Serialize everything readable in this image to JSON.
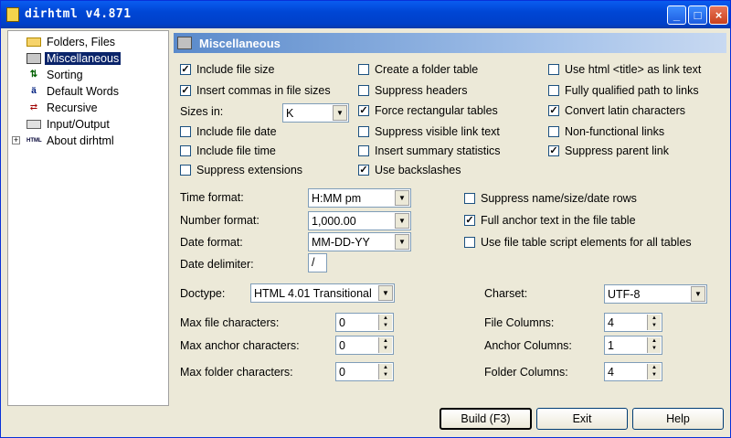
{
  "window": {
    "title": "dirhtml v4.871",
    "min": "_",
    "max": "□",
    "close": "×"
  },
  "tree": {
    "items": [
      {
        "label": "Folders, Files",
        "icon": "folder-icon",
        "selected": false
      },
      {
        "label": "Miscellaneous",
        "icon": "misc-icon",
        "selected": true
      },
      {
        "label": "Sorting",
        "icon": "sort-icon",
        "selected": false
      },
      {
        "label": "Default Words",
        "icon": "words-icon",
        "selected": false
      },
      {
        "label": "Recursive",
        "icon": "recursive-icon",
        "selected": false
      },
      {
        "label": "Input/Output",
        "icon": "io-icon",
        "selected": false
      },
      {
        "label": "About dirhtml",
        "icon": "html-icon",
        "selected": false
      }
    ],
    "expander": "+"
  },
  "header": {
    "title": "Miscellaneous"
  },
  "col1": [
    {
      "label": "Include file size",
      "checked": true
    },
    {
      "label": "Insert commas in file sizes",
      "checked": true
    },
    {
      "label": "Include file date",
      "checked": false
    },
    {
      "label": "Include file time",
      "checked": false
    },
    {
      "label": "Suppress extensions",
      "checked": false
    }
  ],
  "sizes": {
    "label": "Sizes in:",
    "value": "K"
  },
  "col2": [
    {
      "label": "Create a folder table",
      "checked": false
    },
    {
      "label": "Suppress headers",
      "checked": false
    },
    {
      "label": "Force rectangular tables",
      "checked": true
    },
    {
      "label": "Suppress visible link text",
      "checked": false
    },
    {
      "label": "Insert summary statistics",
      "checked": false
    },
    {
      "label": "Use backslashes",
      "checked": true
    }
  ],
  "col3": [
    {
      "label": "Use html <title> as link text",
      "checked": false
    },
    {
      "label": "Fully qualified path to links",
      "checked": false
    },
    {
      "label": "Convert latin characters",
      "checked": true
    },
    {
      "label": "Non-functional links",
      "checked": false
    },
    {
      "label": "Suppress parent link",
      "checked": true
    }
  ],
  "formats": {
    "time": {
      "label": "Time format:",
      "value": "H:MM pm"
    },
    "number": {
      "label": "Number format:",
      "value": "1,000.00"
    },
    "date": {
      "label": "Date format:",
      "value": "MM-DD-YY"
    },
    "delimiter": {
      "label": "Date delimiter:",
      "value": "/"
    }
  },
  "col4": [
    {
      "label": "Suppress name/size/date rows",
      "checked": false
    },
    {
      "label": "Full anchor text in the file table",
      "checked": true
    },
    {
      "label": "Use file table script elements for all tables",
      "checked": false
    }
  ],
  "doctype": {
    "label": "Doctype:",
    "value": "HTML 4.01 Transitional"
  },
  "charset": {
    "label": "Charset:",
    "value": "UTF-8"
  },
  "spins": {
    "max_file": {
      "label": "Max file characters:",
      "value": "0"
    },
    "max_anchor": {
      "label": "Max anchor characters:",
      "value": "0"
    },
    "max_folder": {
      "label": "Max folder characters:",
      "value": "0"
    },
    "file_cols": {
      "label": "File Columns:",
      "value": "4"
    },
    "anchor_cols": {
      "label": "Anchor Columns:",
      "value": "1"
    },
    "folder_cols": {
      "label": "Folder Columns:",
      "value": "4"
    }
  },
  "buttons": {
    "build": "Build (F3)",
    "exit": "Exit",
    "help": "Help"
  },
  "check_mark": "✓"
}
